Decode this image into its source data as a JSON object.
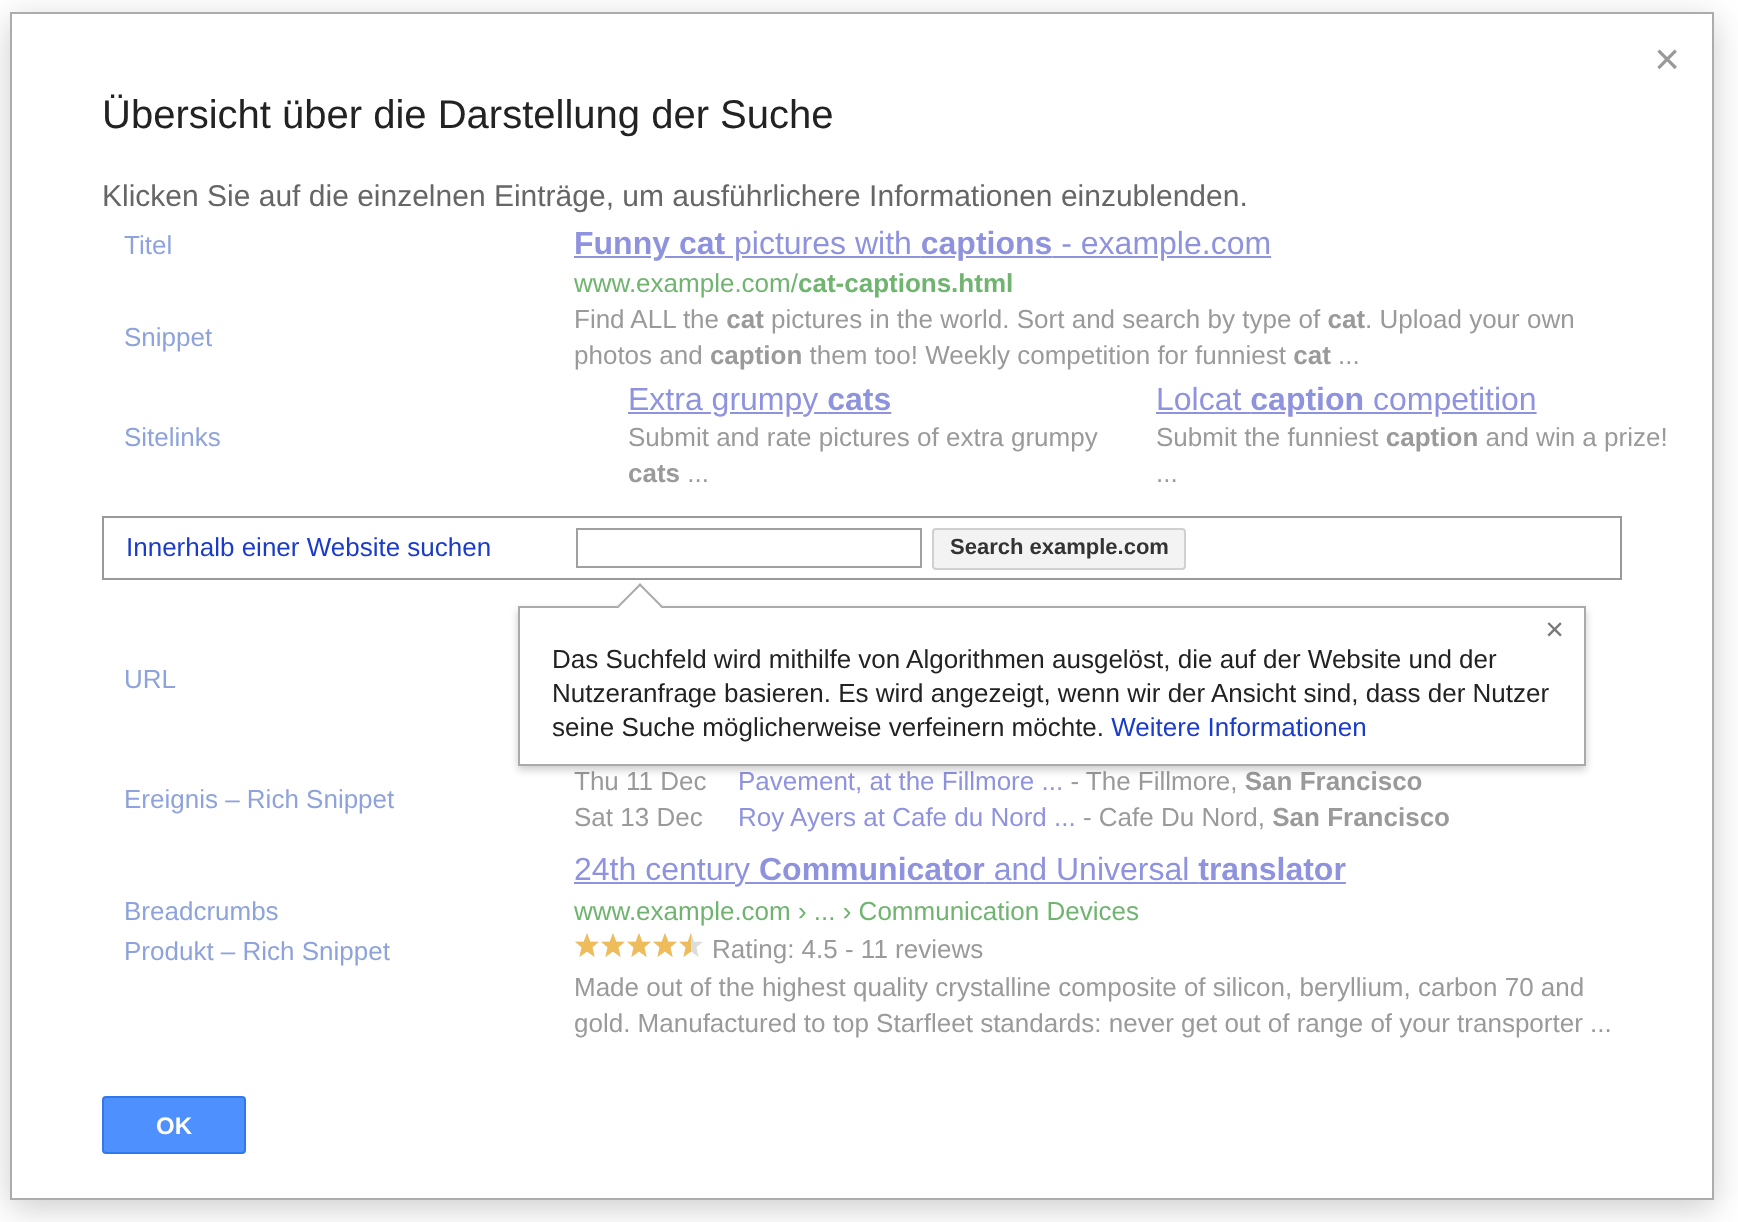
{
  "dialog": {
    "title": "Übersicht über die Darstellung der Suche",
    "subtitle": "Klicken Sie auf die einzelnen Einträge, um ausführlichere Informationen einzublenden.",
    "close": "×"
  },
  "lines": [
    {
      "kind": "title",
      "label": "Titel",
      "text": "**Funny cat** pictures with **captions** - example.com"
    },
    {
      "kind": "url",
      "text": "www.example.com/**cat-captions.html**"
    },
    {
      "kind": "snippet",
      "label": "Snippet",
      "text": "Find ALL the **cat** pictures in the world. Sort and search by type of **cat**. Upload your own photos and **caption** them too! Weekly competition for funniest **cat** ..."
    },
    {
      "kind": "sitelinks",
      "label": "Sitelinks",
      "links": [
        {
          "title": "Extra grumpy **cats**",
          "text": "Submit and rate pictures of extra grumpy **cats** ..."
        },
        {
          "title": "Lolcat **caption** competition",
          "text": "Submit the funniest **caption** and win a prize! ..."
        }
      ]
    },
    {
      "kind": "search",
      "label": "Innerhalb einer Website suchen",
      "button": "Search example.com",
      "selected": true
    },
    {
      "kind": "blank",
      "label": "URL"
    },
    {
      "kind": "events",
      "label": "Ereignis – Rich Snippet",
      "events": [
        {
          "date": "Thu 11 Dec",
          "title": "Pavement, at the Fillmore ...",
          "venue": "- The Fillmore, **San Francisco**"
        },
        {
          "date": "Sat 13 Dec",
          "title": "Roy Ayers at Cafe du Nord ...",
          "venue": "- Cafe Du Nord, **San Francisco**"
        }
      ]
    },
    {
      "kind": "title",
      "text": "24th century **Communicator** and Universal **translator**"
    },
    {
      "kind": "url",
      "label": "Breadcrumbs",
      "text": "www.example.com › ... › Communication Devices"
    },
    {
      "kind": "rating",
      "label": "Produkt – Rich Snippet",
      "stars": 4.5,
      "text": "Rating: 4.5 - 11 reviews"
    },
    {
      "kind": "snippet",
      "text": "Made out of the highest quality crystalline composite of silicon, beryllium, carbon 70 and gold. Manufactured to top Starfleet standards: never get out of range of your transporter ..."
    }
  ],
  "popup": {
    "text": "Das Suchfeld wird mithilfe von Algorithmen ausgelöst, die auf der Website und der Nutzeranfrage basieren. Es wird angezeigt, wenn wir der Ansicht sind, dass der Nutzer seine Suche möglicherweise verfeinern möchte.",
    "link": "Weitere Informationen",
    "close": "×"
  },
  "ok_button": "OK"
}
